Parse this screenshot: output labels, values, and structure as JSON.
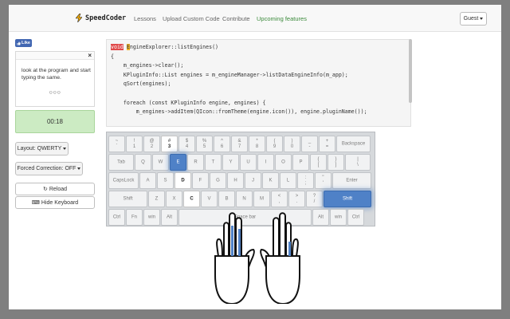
{
  "navbar": {
    "brand": "SpeedCoder",
    "links": [
      "Lessons",
      "Upload Custom Code",
      "Contribute",
      "Upcoming features"
    ],
    "guest_label": "Guest"
  },
  "sidebar": {
    "fb_like": "Like",
    "panel_close": "×",
    "panel_text": "look at the program and start typing the same.",
    "panel_dots": "○○○",
    "timer": "00:18",
    "layout_label": "Layout: QWERTY",
    "forced_correction_label": "Forced Correction: OFF",
    "reload_icon": "↻",
    "reload_label": "Reload",
    "hide_keyboard_icon": "⌨",
    "hide_keyboard_label": "Hide Keyboard"
  },
  "code": {
    "line1_kw": "void",
    "line1_cursor": "E",
    "line1_rest": "ngineExplorer::listEngines()",
    "lines": [
      "{",
      "    m_engines->clear();",
      "    KPluginInfo::List engines = m_engineManager->listDataEngineInfo(m_app);",
      "    qSort(engines);",
      "",
      "    foreach (const KPluginInfo engine, engines) {",
      "        m_engines->addItem(QIcon::fromTheme(engine.icon()), engine.pluginName());"
    ]
  },
  "keyboard": {
    "rows": [
      [
        {
          "top": "~",
          "bot": "`"
        },
        {
          "top": "!",
          "bot": "1"
        },
        {
          "top": "@",
          "bot": "2"
        },
        {
          "top": "#",
          "bot": "3",
          "state": "white"
        },
        {
          "top": "$",
          "bot": "4"
        },
        {
          "top": "%",
          "bot": "5"
        },
        {
          "top": "^",
          "bot": "6"
        },
        {
          "top": "&",
          "bot": "7"
        },
        {
          "top": "*",
          "bot": "8"
        },
        {
          "top": "(",
          "bot": "9"
        },
        {
          "top": ")",
          "bot": "0"
        },
        {
          "top": "_",
          "bot": "-"
        },
        {
          "top": "+",
          "bot": "="
        },
        {
          "mid": "Backspace"
        }
      ],
      [
        {
          "mid": "Tab"
        },
        {
          "mid": "Q"
        },
        {
          "mid": "W"
        },
        {
          "mid": "E",
          "state": "blue"
        },
        {
          "mid": "R"
        },
        {
          "mid": "T"
        },
        {
          "mid": "Y"
        },
        {
          "mid": "U"
        },
        {
          "mid": "I"
        },
        {
          "mid": "O"
        },
        {
          "mid": "P"
        },
        {
          "top": "{",
          "bot": "["
        },
        {
          "top": "}",
          "bot": "]"
        },
        {
          "top": "|",
          "bot": "\\"
        }
      ],
      [
        {
          "mid": "CapsLock"
        },
        {
          "mid": "A"
        },
        {
          "mid": "S"
        },
        {
          "mid": "D",
          "state": "white"
        },
        {
          "mid": "F"
        },
        {
          "mid": "G"
        },
        {
          "mid": "H"
        },
        {
          "mid": "J"
        },
        {
          "mid": "K"
        },
        {
          "mid": "L"
        },
        {
          "top": ":",
          "bot": ";"
        },
        {
          "top": "\"",
          "bot": "'"
        },
        {
          "mid": "Enter"
        }
      ],
      [
        {
          "mid": "Shift"
        },
        {
          "mid": "Z"
        },
        {
          "mid": "X"
        },
        {
          "mid": "C",
          "state": "white"
        },
        {
          "mid": "V"
        },
        {
          "mid": "B"
        },
        {
          "mid": "N"
        },
        {
          "mid": "M"
        },
        {
          "top": "<",
          "bot": ","
        },
        {
          "top": ">",
          "bot": "."
        },
        {
          "top": "?",
          "bot": "/"
        },
        {
          "mid": "Shift",
          "state": "blue"
        }
      ],
      [
        {
          "mid": "Ctrl"
        },
        {
          "mid": "Fn"
        },
        {
          "mid": "win"
        },
        {
          "mid": "Alt"
        },
        {
          "mid": "Space bar"
        },
        {
          "mid": "Alt"
        },
        {
          "mid": "win"
        },
        {
          "mid": "Ctrl"
        }
      ]
    ]
  },
  "colors": {
    "highlight_blue": "#4f81c7",
    "timer_green": "#ccebc3",
    "keyword_red": "#e04a4a",
    "cursor_orange": "#f0b429",
    "nav_green": "#3c8b3c"
  }
}
